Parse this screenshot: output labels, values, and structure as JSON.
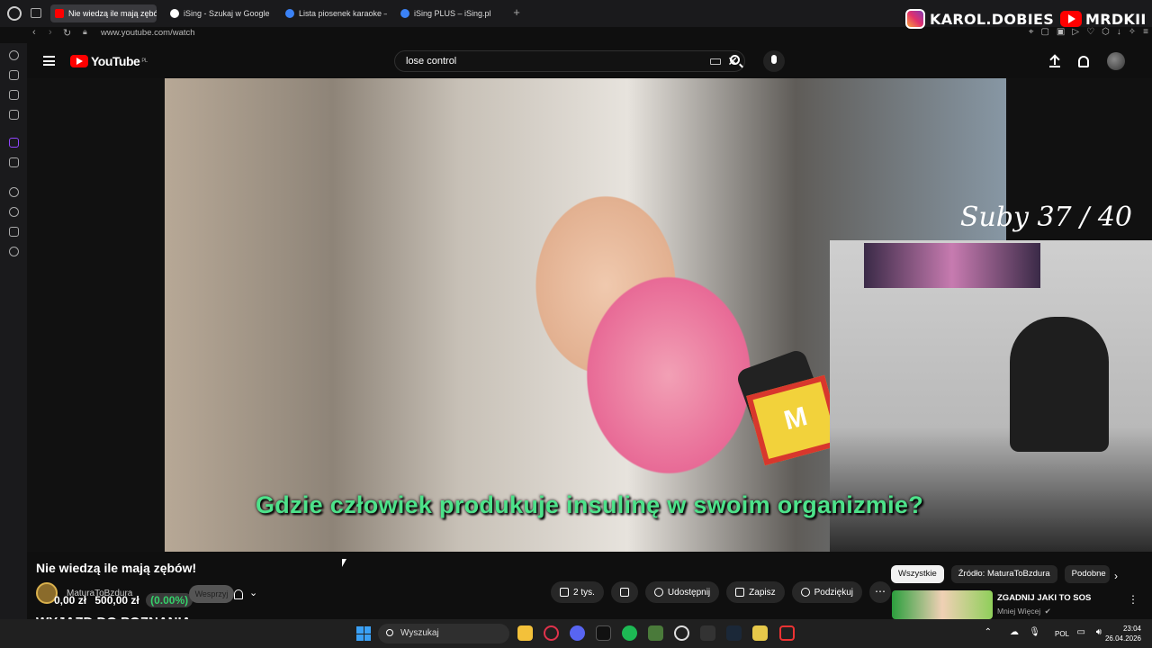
{
  "browser": {
    "tabs": [
      {
        "label": "Nie wiedzą ile mają zębów!",
        "active": true,
        "favicon_color": "#ff0000"
      },
      {
        "label": "iSing - Szukaj w Google",
        "active": false,
        "favicon_color": "#ffffff"
      },
      {
        "label": "Lista piosenek karaoke – i",
        "active": false,
        "favicon_color": "#3b82f6"
      },
      {
        "label": "iSing PLUS – iSing.pl",
        "active": false,
        "favicon_color": "#3b82f6"
      }
    ],
    "url": "www.youtube.com/watch"
  },
  "social": {
    "instagram": "KAROL.DOBIES",
    "youtube": "MRDKII"
  },
  "youtube": {
    "logo_text": "YouTube",
    "region": "PL",
    "search_value": "lose control"
  },
  "video": {
    "overlay_text": "Suby 37 / 40",
    "caption": "Gdzie człowiek produkuje insulinę w swoim organizmie?"
  },
  "details": {
    "title": "Nie wiedzą ile mają zębów!",
    "channel": "MaturaToBzdura",
    "ticker": "0,00 zł",
    "ticker_goal": "500,00 zł",
    "ticker_pct": "(0.00%)",
    "support_label": "Wesprzyj",
    "banner": "WYJAZD DO POZNANIA",
    "actions": [
      {
        "label": "2 tys.",
        "icon": "thumbs-up-icon"
      },
      {
        "label": "",
        "icon": "thumbs-down-icon"
      },
      {
        "label": "Udostępnij",
        "icon": "share-icon"
      },
      {
        "label": "Zapisz",
        "icon": "bookmark-icon"
      },
      {
        "label": "Podziękuj",
        "icon": "thanks-icon"
      }
    ]
  },
  "sidebar_chips": [
    "Wszystkie",
    "Źródło: MaturaToBzdura",
    "Podobne"
  ],
  "recommendation": {
    "title": "ZGADNIJ JAKI TO SOS",
    "channel": "Mniej Więcej"
  },
  "taskbar": {
    "search_placeholder": "Wyszukaj",
    "language": "POL",
    "time": "23:04",
    "date": "26.04.2026"
  },
  "colors": {
    "accent_red": "#ff0000",
    "caption_green": "#4de28a",
    "background": "#0f0f0f"
  }
}
